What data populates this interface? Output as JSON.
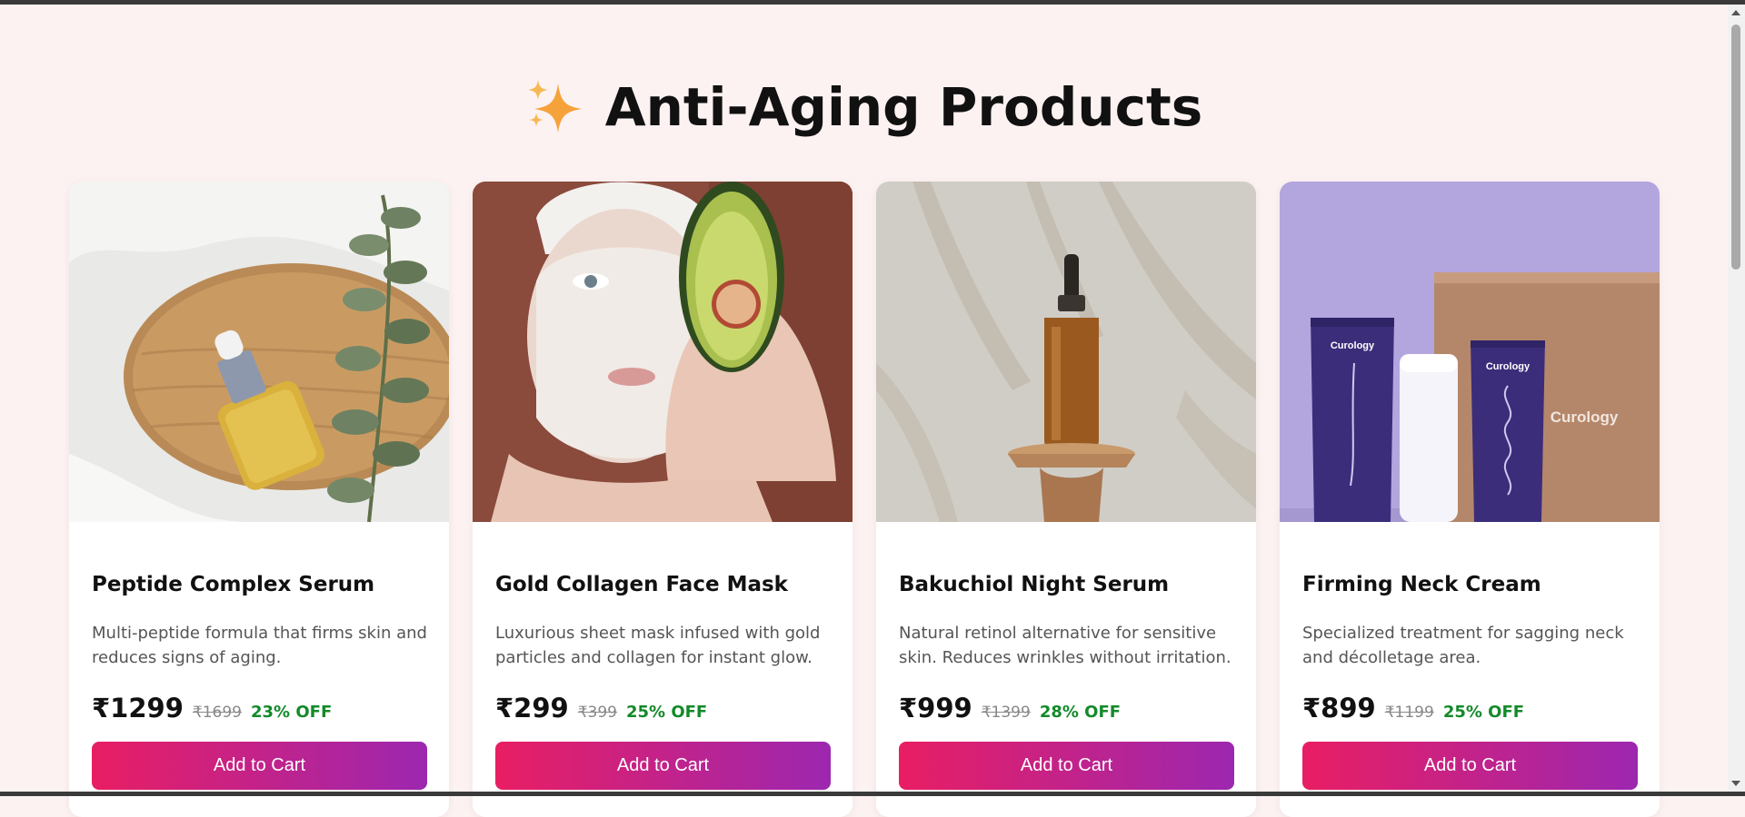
{
  "page": {
    "heading": "Anti-Aging Products",
    "heading_icon": "sparkles-icon"
  },
  "colors": {
    "background": "#fdf2f2",
    "button_gradient_start": "#e91e63",
    "button_gradient_end": "#9c27b0",
    "discount_text": "#138a2a"
  },
  "products": [
    {
      "title": "Peptide Complex Serum",
      "description": "Multi-peptide formula that firms skin and reduces signs of aging.",
      "price": "₹1299",
      "old_price": "₹1699",
      "discount": "23% OFF",
      "button_label": "Add to Cart"
    },
    {
      "title": "Gold Collagen Face Mask",
      "description": "Luxurious sheet mask infused with gold particles and collagen for instant glow.",
      "price": "₹299",
      "old_price": "₹399",
      "discount": "25% OFF",
      "button_label": "Add to Cart"
    },
    {
      "title": "Bakuchiol Night Serum",
      "description": "Natural retinol alternative for sensitive skin. Reduces wrinkles without irritation.",
      "price": "₹999",
      "old_price": "₹1399",
      "discount": "28% OFF",
      "button_label": "Add to Cart"
    },
    {
      "title": "Firming Neck Cream",
      "description": "Specialized treatment for sagging neck and décolletage area.",
      "price": "₹899",
      "old_price": "₹1199",
      "discount": "25% OFF",
      "button_label": "Add to Cart",
      "image_brand_text": "Curology"
    }
  ]
}
